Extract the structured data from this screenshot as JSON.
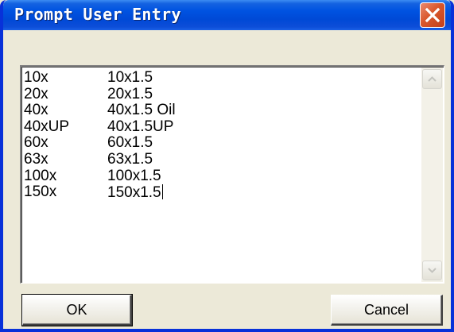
{
  "window": {
    "title": "Prompt User Entry"
  },
  "textarea": {
    "rows": [
      {
        "col1": "10x",
        "col2": "10x1.5"
      },
      {
        "col1": "20x",
        "col2": "20x1.5"
      },
      {
        "col1": "40x",
        "col2": "40x1.5 Oil"
      },
      {
        "col1": "40xUP",
        "col2": "40x1.5UP"
      },
      {
        "col1": "60x",
        "col2": "60x1.5"
      },
      {
        "col1": "63x",
        "col2": "63x1.5"
      },
      {
        "col1": "100x",
        "col2": "100x1.5"
      },
      {
        "col1": "150x",
        "col2": "150x1.5"
      }
    ]
  },
  "buttons": {
    "ok_label": "OK",
    "cancel_label": "Cancel"
  },
  "icons": {
    "close": "close-icon",
    "scroll_up": "arrow-up-icon",
    "scroll_down": "arrow-down-icon"
  },
  "colors": {
    "titlebar": "#0053e1",
    "close_button": "#d9572b",
    "dialog_background": "#ece9d8"
  }
}
